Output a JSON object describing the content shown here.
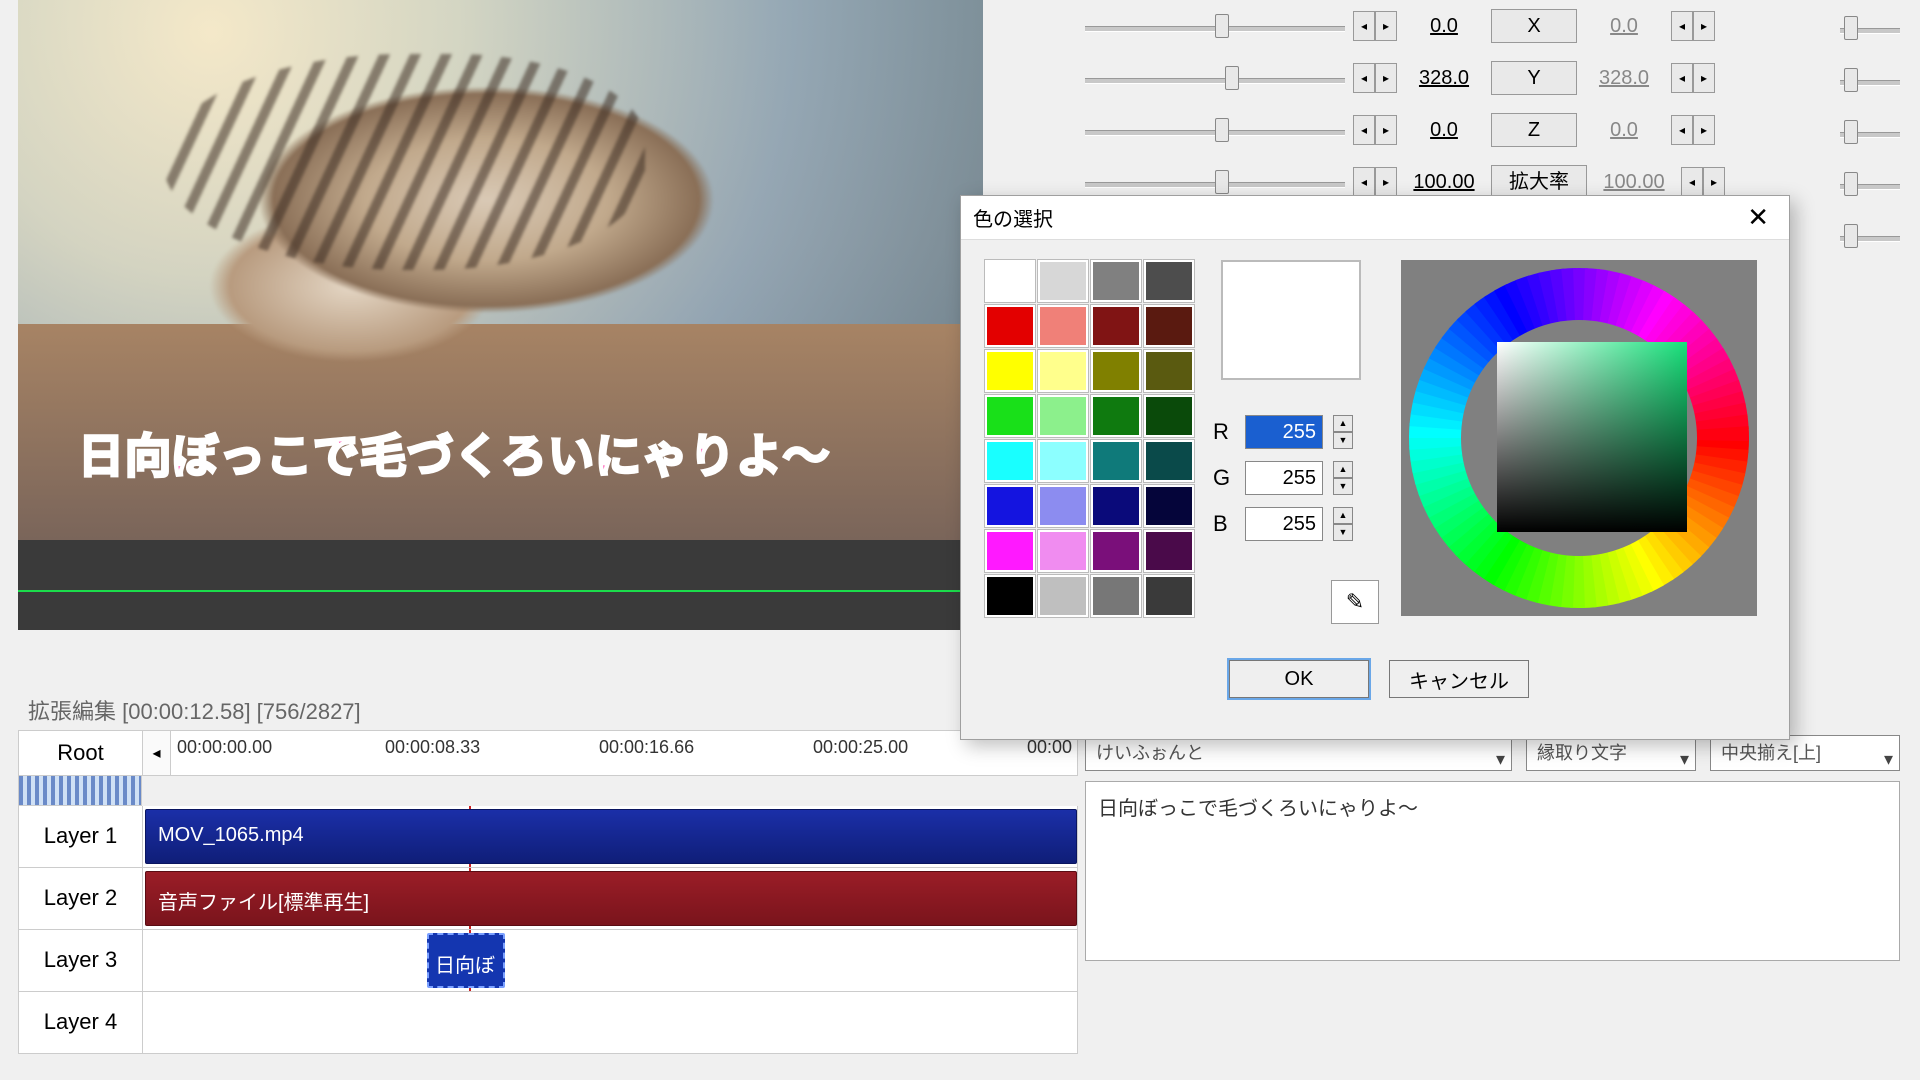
{
  "preview": {
    "caption": "日向ぼっこで毛づくろいにゃりよ〜"
  },
  "props": {
    "rows": [
      {
        "val": "0.0",
        "axis": "X",
        "val_r": "0.0",
        "thumb": 130
      },
      {
        "val": "328.0",
        "axis": "Y",
        "val_r": "328.0",
        "thumb": 140
      },
      {
        "val": "0.0",
        "axis": "Z",
        "val_r": "0.0",
        "thumb": 130
      },
      {
        "val": "100.00",
        "axis": "拡大率",
        "val_r": "100.00",
        "thumb": 130
      }
    ]
  },
  "color_dialog": {
    "title": "色の選択",
    "r_label": "R",
    "g_label": "G",
    "b_label": "B",
    "r": "255",
    "g": "255",
    "b": "255",
    "ok": "OK",
    "cancel": "キャンセル",
    "swatches": [
      "#ffffff",
      "#d7d7d7",
      "#808080",
      "#4d4d4d",
      "#e30000",
      "#f08078",
      "#801414",
      "#5a1a10",
      "#ffff00",
      "#ffff8c",
      "#808000",
      "#5a5a10",
      "#19e019",
      "#8cf08c",
      "#0f7a0f",
      "#0a4a0a",
      "#19ffff",
      "#8cffff",
      "#0f7a7a",
      "#0a4a4a",
      "#1414e0",
      "#8c8cf0",
      "#0a0a7a",
      "#05053a",
      "#ff19ff",
      "#f08cf0",
      "#7a0f7a",
      "#4a0a4a",
      "#000000",
      "#bfbfbf",
      "#777777",
      "#3a3a3a"
    ]
  },
  "timeline": {
    "title": "拡張編集 [00:00:12.58] [756/2827]",
    "root": "Root",
    "ticks": [
      "00:00:00.00",
      "00:00:08.33",
      "00:00:16.66",
      "00:00:25.00",
      "00:00"
    ],
    "layers": [
      "Layer 1",
      "Layer 2",
      "Layer 3",
      "Layer 4"
    ],
    "clips": {
      "video": "MOV_1065.mp4",
      "audio": "音声ファイル[標準再生]",
      "text": "日向ぼ"
    }
  },
  "text_panel": {
    "font": "けいふぉんと",
    "style": "縁取り文字",
    "align": "中央揃え[上]",
    "text": "日向ぼっこで毛づくろいにゃりよ〜"
  }
}
